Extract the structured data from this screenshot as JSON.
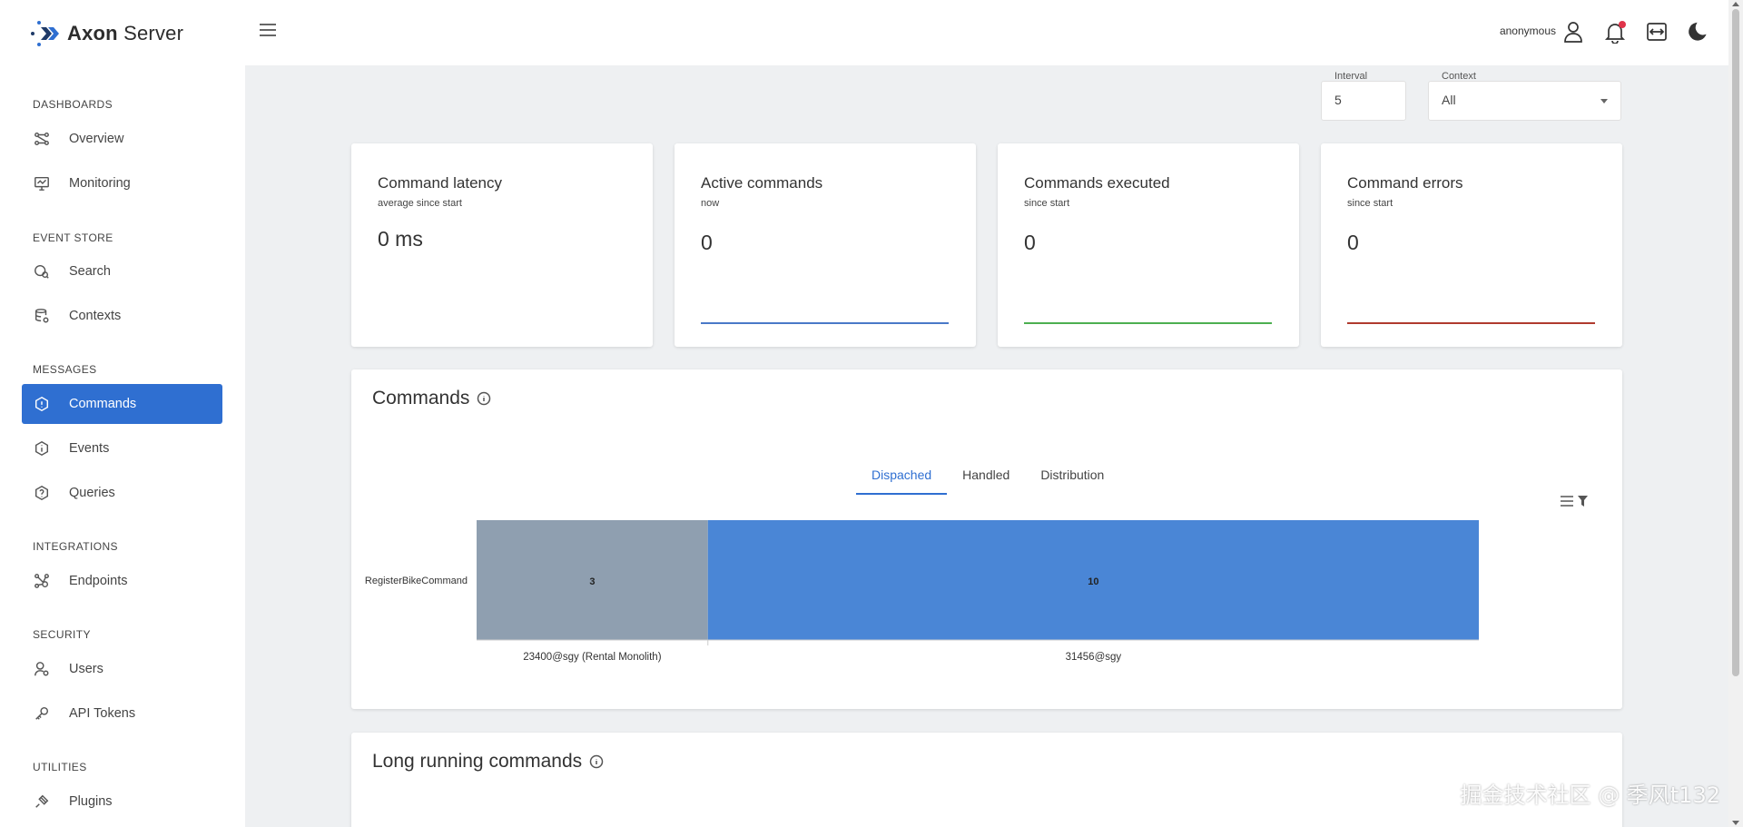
{
  "app": {
    "logo_bold": "Axon",
    "logo_light": "Server"
  },
  "sidebar": {
    "sections": [
      {
        "label": "DASHBOARDS",
        "items": [
          {
            "label": "Overview",
            "icon": "overview-icon"
          },
          {
            "label": "Monitoring",
            "icon": "monitoring-icon"
          }
        ]
      },
      {
        "label": "EVENT STORE",
        "items": [
          {
            "label": "Search",
            "icon": "search-icon"
          },
          {
            "label": "Contexts",
            "icon": "database-icon"
          }
        ]
      },
      {
        "label": "MESSAGES",
        "items": [
          {
            "label": "Commands",
            "icon": "command-icon",
            "active": true
          },
          {
            "label": "Events",
            "icon": "event-icon"
          },
          {
            "label": "Queries",
            "icon": "query-icon"
          }
        ]
      },
      {
        "label": "INTEGRATIONS",
        "items": [
          {
            "label": "Endpoints",
            "icon": "endpoints-icon"
          }
        ]
      },
      {
        "label": "SECURITY",
        "items": [
          {
            "label": "Users",
            "icon": "users-icon"
          },
          {
            "label": "API Tokens",
            "icon": "key-icon"
          }
        ]
      },
      {
        "label": "UTILITIES",
        "items": [
          {
            "label": "Plugins",
            "icon": "plugin-icon"
          }
        ]
      }
    ]
  },
  "header": {
    "user_name": "anonymous"
  },
  "filters": {
    "interval": {
      "label": "Interval",
      "value": "5"
    },
    "context": {
      "label": "Context",
      "value": "All"
    }
  },
  "stats": [
    {
      "title": "Command latency",
      "subtitle": "average since start",
      "value": "0 ms",
      "line_color": ""
    },
    {
      "title": "Active commands",
      "subtitle": "now",
      "value": "0",
      "line_color": "#4a79c8"
    },
    {
      "title": "Commands executed",
      "subtitle": "since start",
      "value": "0",
      "line_color": "#4caf50"
    },
    {
      "title": "Command errors",
      "subtitle": "since start",
      "value": "0",
      "line_color": "#b03a2e"
    }
  ],
  "commands_panel": {
    "title": "Commands",
    "tabs": [
      {
        "label": "Dispached",
        "active": true
      },
      {
        "label": "Handled"
      },
      {
        "label": "Distribution"
      }
    ]
  },
  "chart_data": {
    "type": "bar",
    "orientation": "horizontal",
    "stacked": true,
    "categories": [
      "RegisterBikeCommand"
    ],
    "series": [
      {
        "name": "23400@sgy (Rental Monolith)",
        "values": [
          3
        ],
        "color": "#8f9fb0"
      },
      {
        "name": "31456@sgy",
        "values": [
          10
        ],
        "color": "#4a86d6"
      }
    ],
    "data_labels": [
      "3",
      "10"
    ],
    "segment_labels": [
      "23400@sgy (Rental Monolith)",
      "31456@sgy"
    ]
  },
  "long_running_panel": {
    "title": "Long running commands"
  },
  "watermark": "掘金技术社区 @ 季风t132"
}
